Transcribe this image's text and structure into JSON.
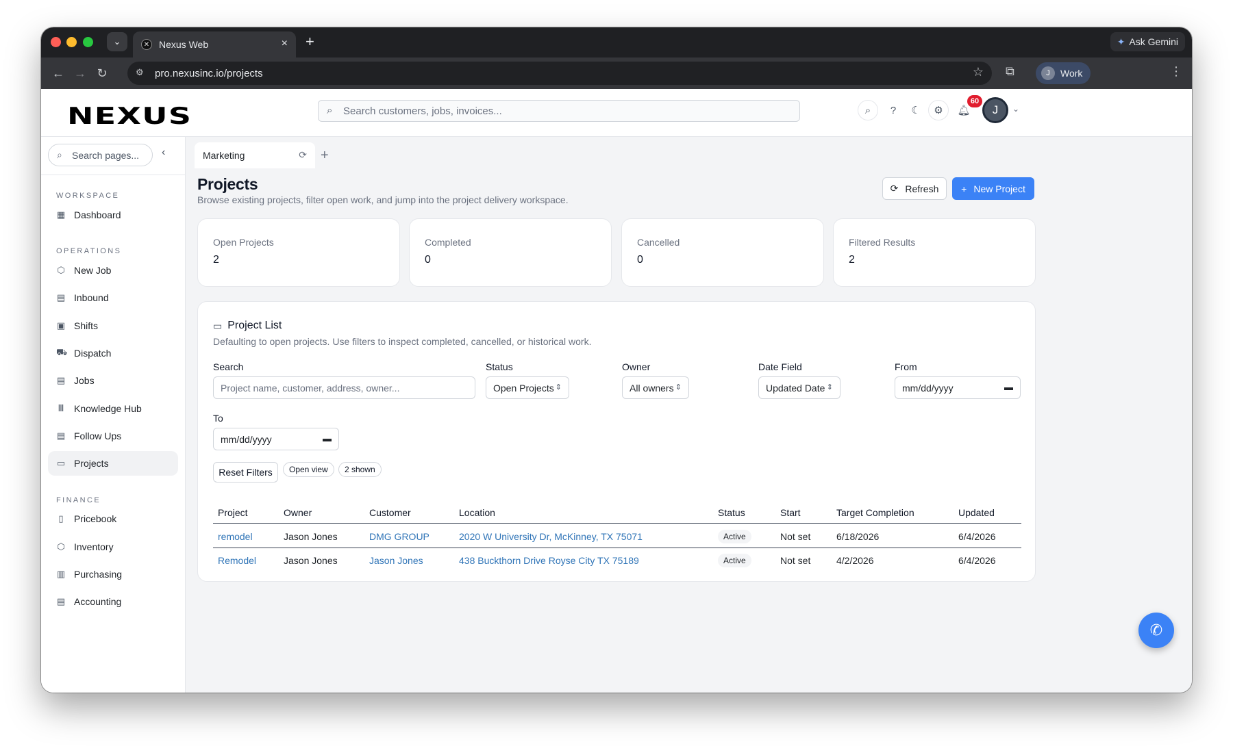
{
  "browser": {
    "tab_title": "Nexus Web",
    "url": "pro.nexusinc.io/projects",
    "ask_gemini": "Ask Gemini",
    "profile_label": "Work",
    "profile_initial": "J"
  },
  "header": {
    "logo": "NEXUS",
    "search_placeholder": "Search customers, jobs, invoices...",
    "notification_count": "60",
    "avatar_initial": "J"
  },
  "sidebar": {
    "search_placeholder": "Search pages...",
    "sections": {
      "workspace": "WORKSPACE",
      "operations": "OPERATIONS",
      "finance": "FINANCE"
    },
    "items": [
      {
        "label": "Dashboard",
        "icon": "grid-icon"
      },
      {
        "label": "New Job",
        "icon": "box-icon"
      },
      {
        "label": "Inbound",
        "icon": "clipboard-icon"
      },
      {
        "label": "Shifts",
        "icon": "calendar-icon"
      },
      {
        "label": "Dispatch",
        "icon": "truck-icon"
      },
      {
        "label": "Jobs",
        "icon": "clipboard-icon"
      },
      {
        "label": "Knowledge Hub",
        "icon": "library-icon"
      },
      {
        "label": "Follow Ups",
        "icon": "document-icon"
      },
      {
        "label": "Projects",
        "icon": "folder-icon"
      },
      {
        "label": "Pricebook",
        "icon": "book-icon"
      },
      {
        "label": "Inventory",
        "icon": "package-icon"
      },
      {
        "label": "Purchasing",
        "icon": "receipt-icon"
      },
      {
        "label": "Accounting",
        "icon": "document-icon"
      }
    ]
  },
  "workspace_tab": {
    "label": "Marketing"
  },
  "page": {
    "title": "Projects",
    "subtitle": "Browse existing projects, filter open work, and jump into the project delivery workspace.",
    "refresh_label": "Refresh",
    "new_project_label": "New Project"
  },
  "stats": [
    {
      "label": "Open Projects",
      "value": "2"
    },
    {
      "label": "Completed",
      "value": "0"
    },
    {
      "label": "Cancelled",
      "value": "0"
    },
    {
      "label": "Filtered Results",
      "value": "2"
    }
  ],
  "project_list": {
    "title": "Project List",
    "description": "Defaulting to open projects. Use filters to inspect completed, cancelled, or historical work.",
    "filters": {
      "search_label": "Search",
      "search_placeholder": "Project name, customer, address, owner...",
      "status_label": "Status",
      "status_value": "Open Projects",
      "owner_label": "Owner",
      "owner_value": "All owners",
      "date_field_label": "Date Field",
      "date_field_value": "Updated Date",
      "from_label": "From",
      "from_value": "mm/dd/yyyy",
      "to_label": "To",
      "to_value": "mm/dd/yyyy"
    },
    "reset_label": "Reset Filters",
    "view_pill": "Open view",
    "count_pill": "2 shown",
    "columns": [
      "Project",
      "Owner",
      "Customer",
      "Location",
      "Status",
      "Start",
      "Target Completion",
      "Updated"
    ],
    "rows": [
      {
        "project": "remodel",
        "owner": "Jason Jones",
        "customer": "DMG GROUP",
        "location": "2020 W University Dr, McKinney, TX 75071",
        "status": "Active",
        "start": "Not set",
        "target": "6/18/2026",
        "updated": "6/4/2026"
      },
      {
        "project": "Remodel",
        "owner": "Jason Jones",
        "customer": "Jason Jones",
        "location": "438 Buckthorn Drive Royse City TX 75189",
        "status": "Active",
        "start": "Not set",
        "target": "4/2/2026",
        "updated": "6/4/2026"
      }
    ]
  },
  "colors": {
    "accent": "#3b82f6",
    "link": "#2f74b7",
    "notification": "#e11d2e"
  }
}
